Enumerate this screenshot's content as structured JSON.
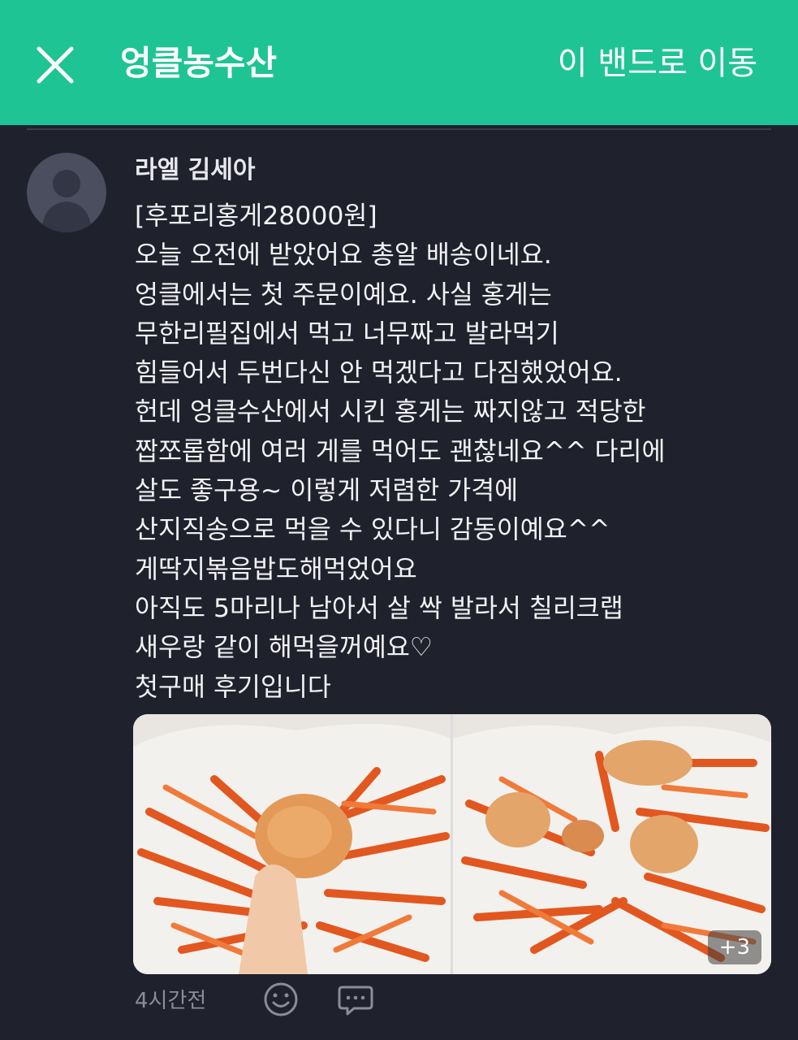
{
  "header": {
    "close_icon": "close-icon",
    "title": "엉클농수산",
    "move_label": "이 밴드로 이동",
    "bg_color": "#1ec494"
  },
  "post": {
    "author": "라엘 김세아",
    "lines": [
      "[후포리홍게28000원]",
      "오늘 오전에 받았어요 총알 배송이네요.",
      "엉클에서는 첫 주문이예요. 사실 홍게는",
      "무한리필집에서 먹고 너무짜고 발라먹기",
      "힘들어서 두번다신 안 먹겠다고 다짐했었어요.",
      "헌데 엉클수산에서 시킨 홍게는 짜지않고 적당한",
      "짭쪼롭함에 여러 게를 먹어도 괜찮네요^^ 다리에",
      "살도 좋구용~ 이렇게 저렴한 가격에",
      "산지직송으로 먹을 수 있다니 감동이예요^^",
      "게딱지볶음밥도해먹었어요",
      "아직도 5마리나 남아서 살 싹 발라서 칠리크랩",
      "새우랑 같이 해먹을꺼예요♡",
      "첫구매 후기입니다"
    ],
    "more_photos": "+3",
    "time": "4시간전",
    "emotion_icon": "smiley-icon",
    "comment_icon": "comment-icon"
  }
}
